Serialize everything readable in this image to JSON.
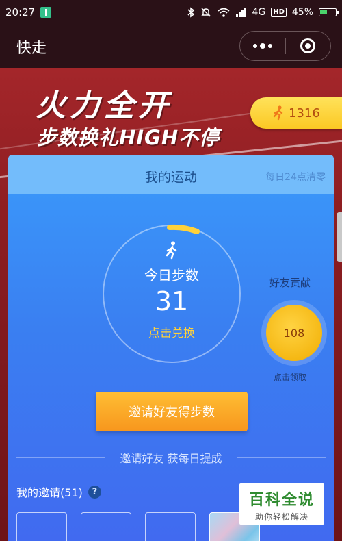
{
  "status_bar": {
    "time": "20:27",
    "network": "4G",
    "hd_badge": "HD",
    "battery": "45%"
  },
  "header": {
    "title": "快走"
  },
  "banner": {
    "headline": "火力全开",
    "subline": "步数换礼HIGH不停",
    "points": "1316"
  },
  "card": {
    "title": "我的运动",
    "reset_note": "每日24点清零",
    "today_label": "今日步数",
    "today_steps": "31",
    "exchange_label": "点击兑换",
    "friend_contrib_title": "好友贡献",
    "friend_contrib_value": "108",
    "claim_label": "点击领取",
    "invite_button": "邀请好友得步数",
    "invite_divider": "邀请好友 获每日提成",
    "my_invites_label": "我的邀请(51)",
    "help_symbol": "?"
  },
  "watermark": {
    "title": "百科全说",
    "subtitle": "助你轻松解决"
  },
  "colors": {
    "accent_yellow": "#ffd23a",
    "button_orange": "#f7961d",
    "card_blue": "#3a87f5",
    "header_bg": "#2a1117"
  },
  "icons": [
    "usb-icon",
    "bluetooth-icon",
    "mute-icon",
    "wifi-icon",
    "signal-icon",
    "battery-icon",
    "more-dots-icon",
    "target-icon",
    "runner-icon",
    "help-icon"
  ]
}
